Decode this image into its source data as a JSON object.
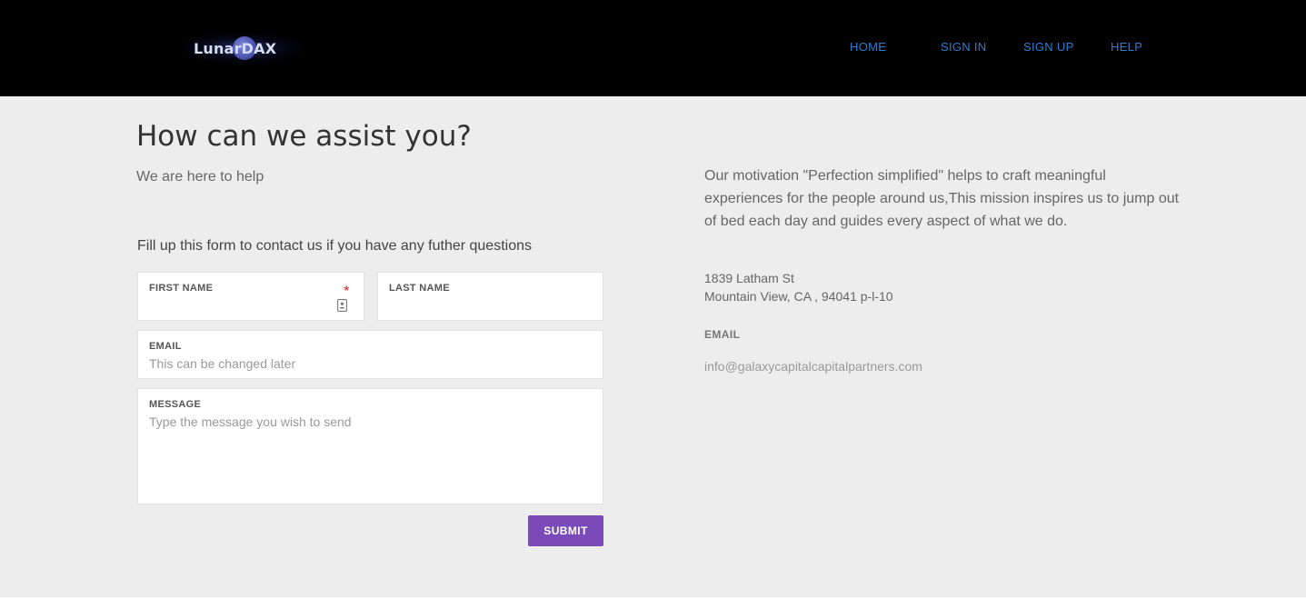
{
  "brand": {
    "name": "LunarDAX"
  },
  "nav": {
    "items": [
      {
        "label": "HOME"
      },
      {
        "label": "SIGN IN"
      },
      {
        "label": "SIGN UP"
      },
      {
        "label": "HELP"
      }
    ]
  },
  "hero": {
    "title": "How can we assist you?",
    "subtitle": "We are here to help"
  },
  "form": {
    "intro": "Fill up this form to contact us if you have any futher questions",
    "first_name": {
      "label": "FIRST NAME",
      "value": "",
      "required_mark": "*"
    },
    "last_name": {
      "label": "LAST NAME",
      "value": ""
    },
    "email": {
      "label": "EMAIL",
      "value": "",
      "placeholder": "This can be changed later"
    },
    "message": {
      "label": "MESSAGE",
      "value": "",
      "placeholder": "Type the message you wish to send"
    },
    "submit_label": "SUBMIT"
  },
  "info": {
    "mission": "Our motivation \"Perfection simplified\" helps to craft meaningful experiences for the people around us,This mission inspires us to jump out of bed each day and guides every aspect of what we do.",
    "address_line1": "1839 Latham St",
    "address_line2": "Mountain View, CA , 94041 p-l-10",
    "email_heading": "EMAIL",
    "email": "info@galaxycapitalcapitalpartners.com"
  },
  "colors": {
    "header_bg": "#000000",
    "nav_link": "#2f7bd0",
    "page_bg": "#ededed",
    "submit_bg": "#7a4bb8",
    "required": "#e04848"
  },
  "icons": {
    "first_name_field": "contact-card-icon",
    "logo": "moon-icon"
  }
}
